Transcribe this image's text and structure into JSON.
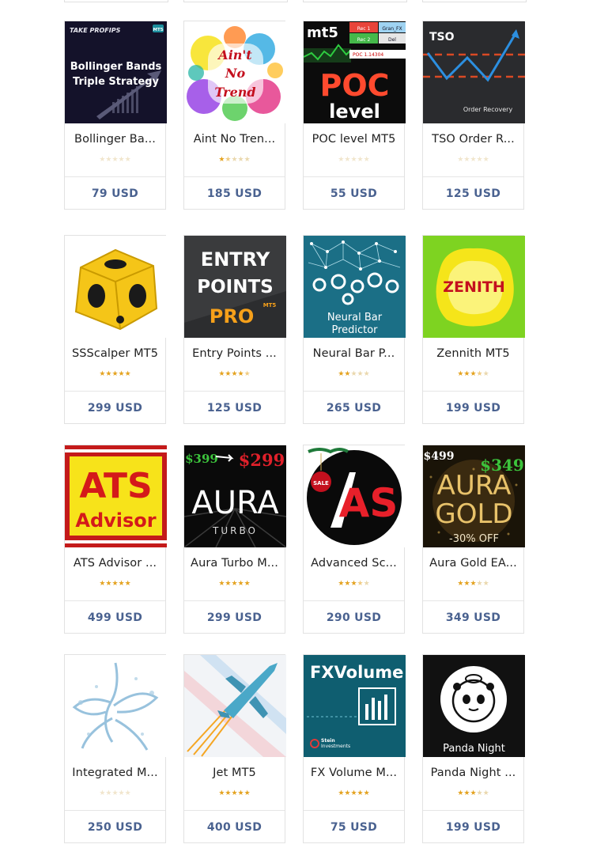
{
  "products": [
    {
      "name": "Bollinger Ba...",
      "price": "79 USD",
      "rating": 0,
      "thumb": "bollinger-bands-cover",
      "thumb_text": [
        "TAKE PROFIPS",
        "MT5",
        "Bollinger Bands",
        "Triple Strategy"
      ]
    },
    {
      "name": "Aint No Tren...",
      "price": "185 USD",
      "rating": 1.5,
      "thumb": "aint-no-trend-cover",
      "thumb_text": [
        "Ain't",
        "No",
        "Trend"
      ]
    },
    {
      "name": "POC level MT5",
      "price": "55 USD",
      "rating": 0,
      "thumb": "poc-level-cover",
      "thumb_text": [
        "mt5",
        "Rec 1",
        "Gran_FX",
        "Rec 2",
        "Del",
        "POC 1.14304",
        "POC",
        "level"
      ]
    },
    {
      "name": "TSO Order R...",
      "price": "125 USD",
      "rating": 0,
      "thumb": "tso-order-recovery-cover",
      "thumb_text": [
        "TSO",
        "Order Recovery"
      ]
    },
    {
      "name": "SSScalper MT5",
      "price": "299 USD",
      "rating": 5,
      "thumb": "ssscalper-cube-cover",
      "thumb_text": []
    },
    {
      "name": "Entry Points ...",
      "price": "125 USD",
      "rating": 4.5,
      "thumb": "entry-points-pro-cover",
      "thumb_text": [
        "ENTRY",
        "POINTS",
        "PRO",
        "MT5"
      ]
    },
    {
      "name": "Neural Bar P...",
      "price": "265 USD",
      "rating": 2,
      "thumb": "neural-bar-predictor-cover",
      "thumb_text": [
        "Neural Bar",
        "Predictor"
      ]
    },
    {
      "name": "Zennith MT5",
      "price": "199 USD",
      "rating": 3.5,
      "thumb": "zennith-cover",
      "thumb_text": [
        "ZENITH"
      ]
    },
    {
      "name": "ATS Advisor ...",
      "price": "499 USD",
      "rating": 5,
      "thumb": "ats-advisor-cover",
      "thumb_text": [
        "ATS",
        "Advisor"
      ]
    },
    {
      "name": "Aura Turbo M...",
      "price": "299 USD",
      "rating": 5,
      "thumb": "aura-turbo-cover",
      "thumb_text": [
        "$399",
        "$299",
        "AURA",
        "TURBO"
      ]
    },
    {
      "name": "Advanced Sc...",
      "price": "290 USD",
      "rating": 3.5,
      "thumb": "advanced-scalper-cover",
      "thumb_text": [
        "SALE",
        "AS"
      ]
    },
    {
      "name": "Aura Gold EA...",
      "price": "349 USD",
      "rating": 3,
      "thumb": "aura-gold-cover",
      "thumb_text": [
        "$499",
        "$349",
        "AURA",
        "GOLD",
        "-30% OFF"
      ]
    },
    {
      "name": "Integrated M...",
      "price": "250 USD",
      "rating": 0,
      "thumb": "water-splash-cover",
      "thumb_text": []
    },
    {
      "name": "Jet MT5",
      "price": "400 USD",
      "rating": 5,
      "thumb": "jet-fighter-cover",
      "thumb_text": []
    },
    {
      "name": "FX Volume M...",
      "price": "75 USD",
      "rating": 5,
      "thumb": "fx-volume-cover",
      "thumb_text": [
        "FXVolume",
        "Stein",
        "Investments"
      ]
    },
    {
      "name": "Panda Night ...",
      "price": "199 USD",
      "rating": 3,
      "thumb": "panda-night-cover",
      "thumb_text": [
        "Panda Night"
      ]
    }
  ],
  "colors": {
    "price": "#4a6290",
    "star_on": "#e4a321",
    "star_off": "#ead8ae",
    "card_border": "#e2e2e2"
  }
}
